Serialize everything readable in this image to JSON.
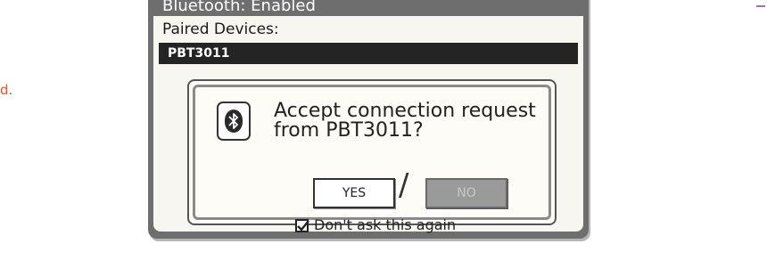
{
  "side_marks": {
    "left_text": "d."
  },
  "window": {
    "title": "Bluetooth: Enabled"
  },
  "paired": {
    "label": "Paired Devices:",
    "devices": [
      {
        "name": "PBT3011"
      }
    ]
  },
  "dialog": {
    "icon": "bluetooth-icon",
    "message": "Accept connection request\nfrom PBT3011?",
    "yes_label": "YES",
    "separator": "/",
    "no_label": "NO",
    "checkbox_label": "Don't ask this again",
    "checkbox_checked": true
  }
}
